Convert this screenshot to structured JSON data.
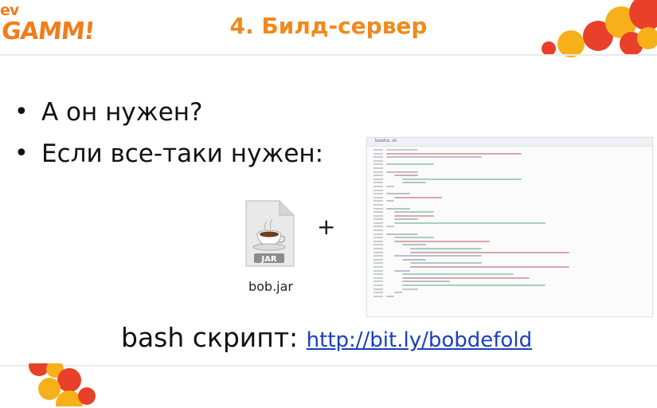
{
  "header": {
    "logo_top": "ev",
    "logo_main": "GAMM!",
    "title": "4. Билд-сервер"
  },
  "bullets": [
    "А он нужен?",
    "Если все-таки нужен:"
  ],
  "jar": {
    "badge": "JAR",
    "label": "bob.jar"
  },
  "plus": "+",
  "code_screenshot": {
    "file_name": "bundle.sh"
  },
  "footer": {
    "prefix": "bash скрипт: ",
    "link_text": "http://bit.ly/bobdefold"
  },
  "colors": {
    "accent_orange": "#f08a1c",
    "bubble_red": "#e8402a",
    "bubble_yellow": "#f6b11a",
    "link_blue": "#1a3fbf"
  }
}
